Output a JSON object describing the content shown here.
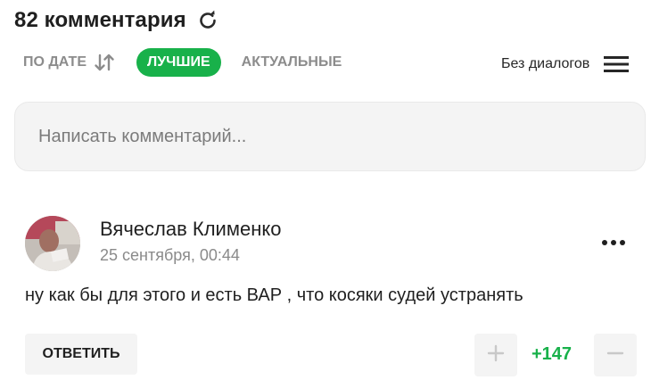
{
  "header": {
    "comments_title": "82 комментария",
    "refresh_icon": "refresh-icon"
  },
  "sort": {
    "by_date_label": "ПО ДАТЕ",
    "by_date_icon": "sort-arrows-icon",
    "best_label": "ЛУЧШИЕ",
    "actual_label": "АКТУАЛЬНЫЕ",
    "active": "ЛУЧШИЕ"
  },
  "dialog_toggle": {
    "label": "Без диалогов",
    "icon": "hamburger-icon"
  },
  "comment_input": {
    "placeholder": "Написать комментарий...",
    "value": ""
  },
  "comment": {
    "author": "Вячеслав Клименко",
    "date": "25 сентября, 00:44",
    "text": "ну как бы для этого и есть ВАР , что косяки судей устранять",
    "reply_label": "ОТВЕТИТЬ",
    "score": "+147",
    "more_icon": "more-dots-icon",
    "upvote_icon": "plus-icon",
    "downvote_icon": "minus-icon"
  },
  "colors": {
    "accent": "#18b14a",
    "muted": "#8c8c8c",
    "panel": "#f4f4f4"
  }
}
